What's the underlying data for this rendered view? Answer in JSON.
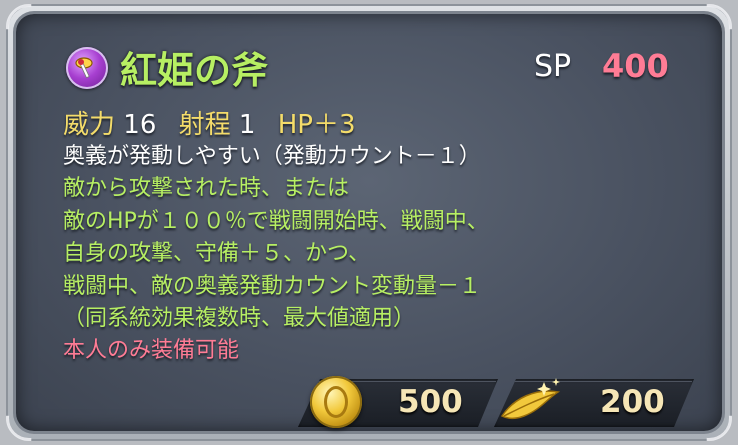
{
  "skill": {
    "name": "紅姫の斧",
    "icon": "weapon-skill-icon",
    "sp_label": "SP",
    "sp_value": "400"
  },
  "stats": {
    "might_label": "威力",
    "might_value": "16",
    "range_label": "射程",
    "range_value": "1",
    "bonus": "HP＋3"
  },
  "description": [
    {
      "text": "奥義が発動しやすい（発動カウント－１）",
      "color": "white"
    },
    {
      "text": "敵から攻撃された時、または",
      "color": "green"
    },
    {
      "text": "敵のHPが１００％で戦闘開始時、戦闘中、",
      "color": "green"
    },
    {
      "text": "自身の攻撃、守備＋５、かつ、",
      "color": "green"
    },
    {
      "text": "戦闘中、敵の奥義発動カウント変動量－１",
      "color": "green"
    },
    {
      "text": "（同系統効果複数時、最大値適用）",
      "color": "green"
    },
    {
      "text": "本人のみ装備可能",
      "color": "pink"
    }
  ],
  "costs": {
    "coin_icon": "gold-coin-icon",
    "coin_value": "500",
    "feather_icon": "golden-feather-icon",
    "feather_value": "200"
  },
  "colors": {
    "green_text": "#b7ef63",
    "pink_text": "#ff7c95",
    "yellow_label": "#f4dc6a",
    "panel_bg": "#4a5261"
  }
}
